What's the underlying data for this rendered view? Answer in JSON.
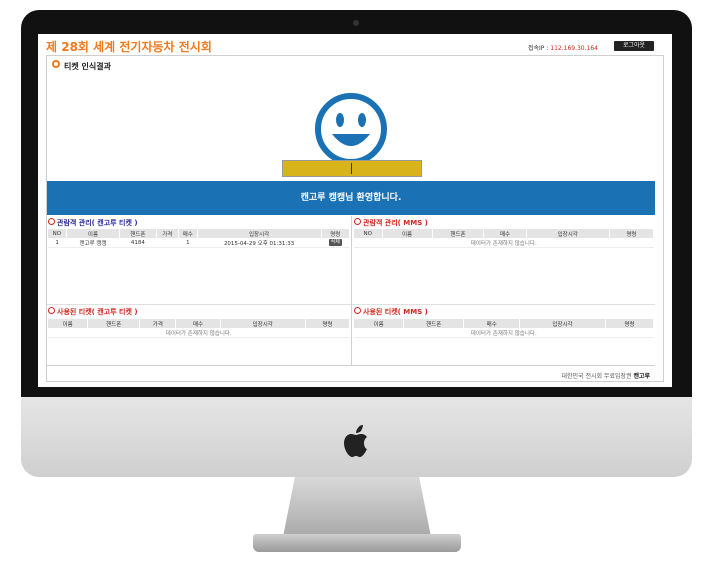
{
  "header": {
    "title": "제 28회 세계 전기자동차 전시회",
    "ip_label": "접속IP : ",
    "ip_value": "112.169.30.164",
    "logout": "로그아웃"
  },
  "section_title": "티켓 인식결과",
  "welcome": "캔고루 캥캥님 환영합니다.",
  "visitor_kangaroo": {
    "title": "관람객 관리( 캔고루 티켓 )",
    "columns": [
      "NO",
      "이름",
      "핸드폰",
      "가격",
      "매수",
      "입장시각",
      "명령"
    ],
    "rows": [
      {
        "no": "1",
        "name": "캔고루 캥캥",
        "phone": "4184",
        "price": "",
        "qty": "1",
        "time": "2015-04-29 오후 01:31:33",
        "cmd": "삭제"
      }
    ]
  },
  "visitor_mms": {
    "title": "관람객 관리( MMS )",
    "columns": [
      "NO",
      "이름",
      "핸드폰",
      "매수",
      "입장시각",
      "명령"
    ],
    "empty": "데이터가 존재하지 않습니다."
  },
  "used_kangaroo": {
    "title": "사용된 티켓( 캔고루 티켓 )",
    "columns": [
      "이름",
      "핸드폰",
      "가격",
      "매수",
      "입장시각",
      "명령"
    ],
    "empty": "데이터가 존재하지 않습니다."
  },
  "used_mms": {
    "title": "사용된 티켓( MMS )",
    "columns": [
      "이름",
      "핸드폰",
      "매수",
      "입장시각",
      "명령"
    ],
    "empty": "데이터가 존재하지 않습니다."
  },
  "footer": {
    "text": "대한민국 전시회 무료입장권 ",
    "brand": "캔고루"
  },
  "colors": {
    "title": "#f07a1f",
    "welcome_bar": "#1a71b3",
    "input": "#d8b41a"
  }
}
